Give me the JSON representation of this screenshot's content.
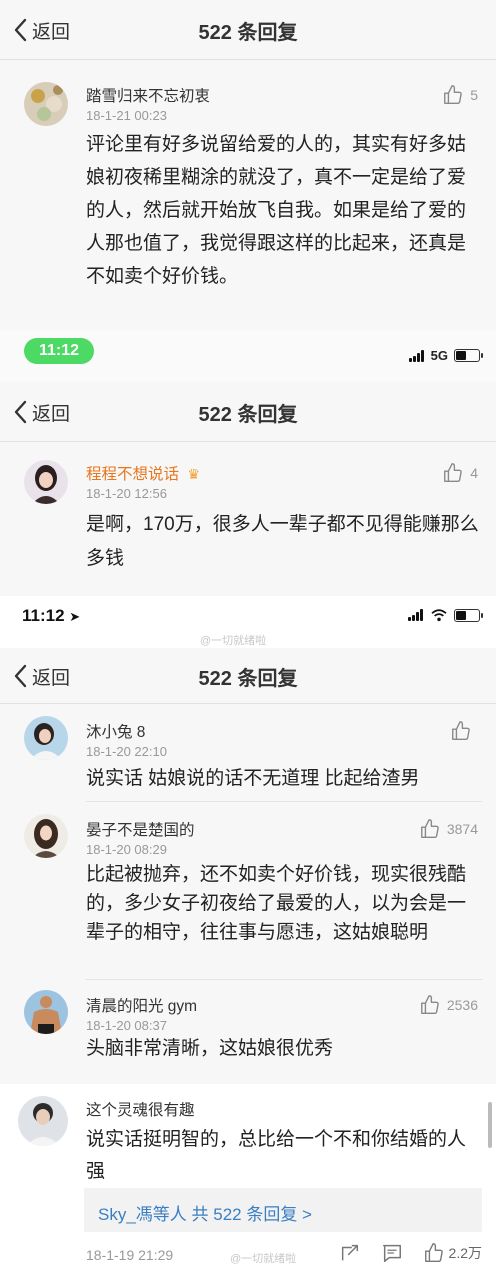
{
  "nav": {
    "back_label": "返回",
    "title": "522 条回复"
  },
  "statusbar1": {
    "time": "11:12",
    "network": "5G"
  },
  "statusbar2": {
    "time": "11:12",
    "watermark": "@一切就绪啦"
  },
  "comments1": [
    {
      "user": "踏雪归来不忘初衷",
      "time": "18-1-21 00:23",
      "likes": "5",
      "text": "评论里有好多说留给爱的人的，其实有好多姑娘初夜稀里糊涂的就没了，真不一定是给了爱的人，然后就开始放飞自我。如果是给了爱的人那也值了，我觉得跟这样的比起来，还真是不如卖个好价钱。"
    }
  ],
  "comments2": [
    {
      "user": "程程不想说话",
      "time": "18-1-20 12:56",
      "likes": "4",
      "text": "是啊，170万，很多人一辈子都不见得能赚那么多钱"
    }
  ],
  "comments3": [
    {
      "user": "沐小兔 8",
      "time": "18-1-20 22:10",
      "likes": "",
      "text": "说实话 姑娘说的话不无道理 比起给渣男"
    },
    {
      "user": "晏子不是楚国的",
      "time": "18-1-20 08:29",
      "likes": "3874",
      "text": "比起被抛弃，还不如卖个好价钱，现实很残酷的，多少女子初夜给了最爱的人，以为会是一辈子的相守，往往事与愿违，这姑娘聪明"
    },
    {
      "user": "清晨的阳光 gym",
      "time": "18-1-20 08:37",
      "likes": "2536",
      "text": "头脑非常清晰，这姑娘很优秀"
    }
  ],
  "post": {
    "user": "这个灵魂很有趣",
    "text": "说实话挺明智的，总比给一个不和你结婚的人强",
    "more_replies": "Sky_馮等人  共 522 条回复 >",
    "time": "18-1-19 21:29",
    "like_count": "2.2万",
    "watermark": "@一切就绪啦"
  },
  "colors": {
    "accent_link": "#3a7fc4",
    "username_vip": "#e8761d",
    "pill_green": "#4cd964"
  },
  "icons": [
    "back-chevron-icon",
    "thumbs-up-icon",
    "signal-icon",
    "wifi-icon",
    "battery-icon",
    "location-arrow-icon",
    "share-icon",
    "comment-icon",
    "repost-icon",
    "crown-icon"
  ]
}
